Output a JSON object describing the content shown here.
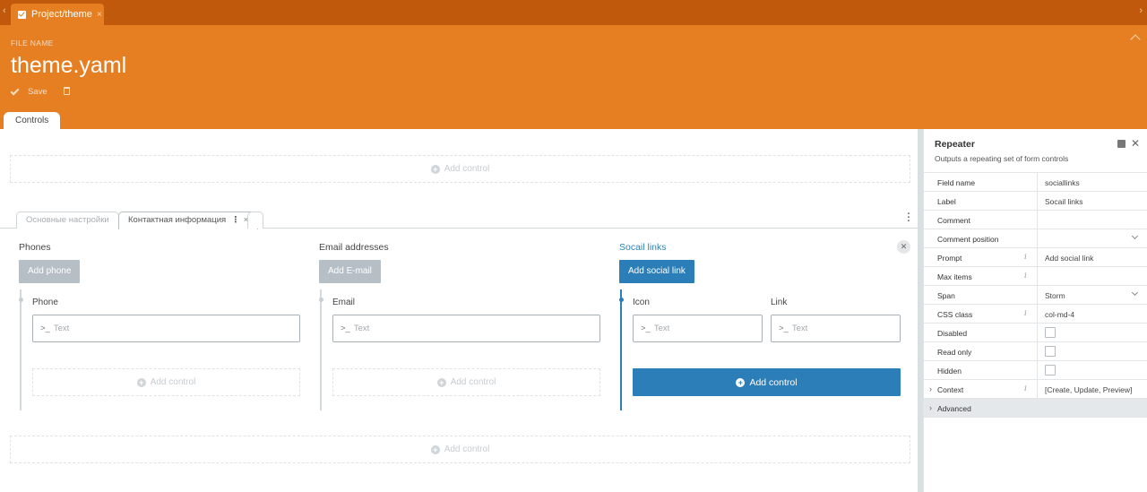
{
  "tabstrip": {
    "tab_label": "Project/theme",
    "close": "×",
    "nav_left": "‹",
    "nav_right": "›"
  },
  "header": {
    "file_name_label": "FILE NAME",
    "file_name": "theme.yaml",
    "save_label": "Save"
  },
  "main_tab": "Controls",
  "add_control_label": "Add control",
  "inner_tabs": [
    {
      "label": "Основные настройки"
    },
    {
      "label": "Контактная информация"
    }
  ],
  "columns": {
    "phones": {
      "title": "Phones",
      "button": "Add phone",
      "field_label": "Phone",
      "placeholder": "Text"
    },
    "emails": {
      "title": "Email addresses",
      "button": "Add E-mail",
      "field_label": "Email",
      "placeholder": "Text"
    },
    "social": {
      "title": "Socail links",
      "button": "Add social link",
      "icon_label": "Icon",
      "link_label": "Link",
      "placeholder": "Text",
      "add_control": "Add control"
    }
  },
  "prompt_symbol": ">_",
  "inspector": {
    "title": "Repeater",
    "description": "Outputs a repeating set of form controls",
    "rows": {
      "field_name": {
        "key": "Field name",
        "value": "sociallinks"
      },
      "label": {
        "key": "Label",
        "value": "Socail links"
      },
      "comment": {
        "key": "Comment",
        "value": ""
      },
      "comment_position": {
        "key": "Comment position",
        "value": ""
      },
      "prompt": {
        "key": "Prompt",
        "value": "Add social link"
      },
      "max_items": {
        "key": "Max items",
        "value": ""
      },
      "span": {
        "key": "Span",
        "value": "Storm"
      },
      "css_class": {
        "key": "CSS class",
        "value": "col-md-4"
      },
      "disabled": {
        "key": "Disabled"
      },
      "read_only": {
        "key": "Read only"
      },
      "hidden": {
        "key": "Hidden"
      },
      "context": {
        "key": "Context",
        "value": "[Create, Update, Preview]"
      },
      "advanced": {
        "key": "Advanced"
      }
    }
  },
  "colors": {
    "header_orange": "#e67e22",
    "tabstrip_orange": "#c0590c",
    "accent_blue": "#2c7eb8"
  }
}
